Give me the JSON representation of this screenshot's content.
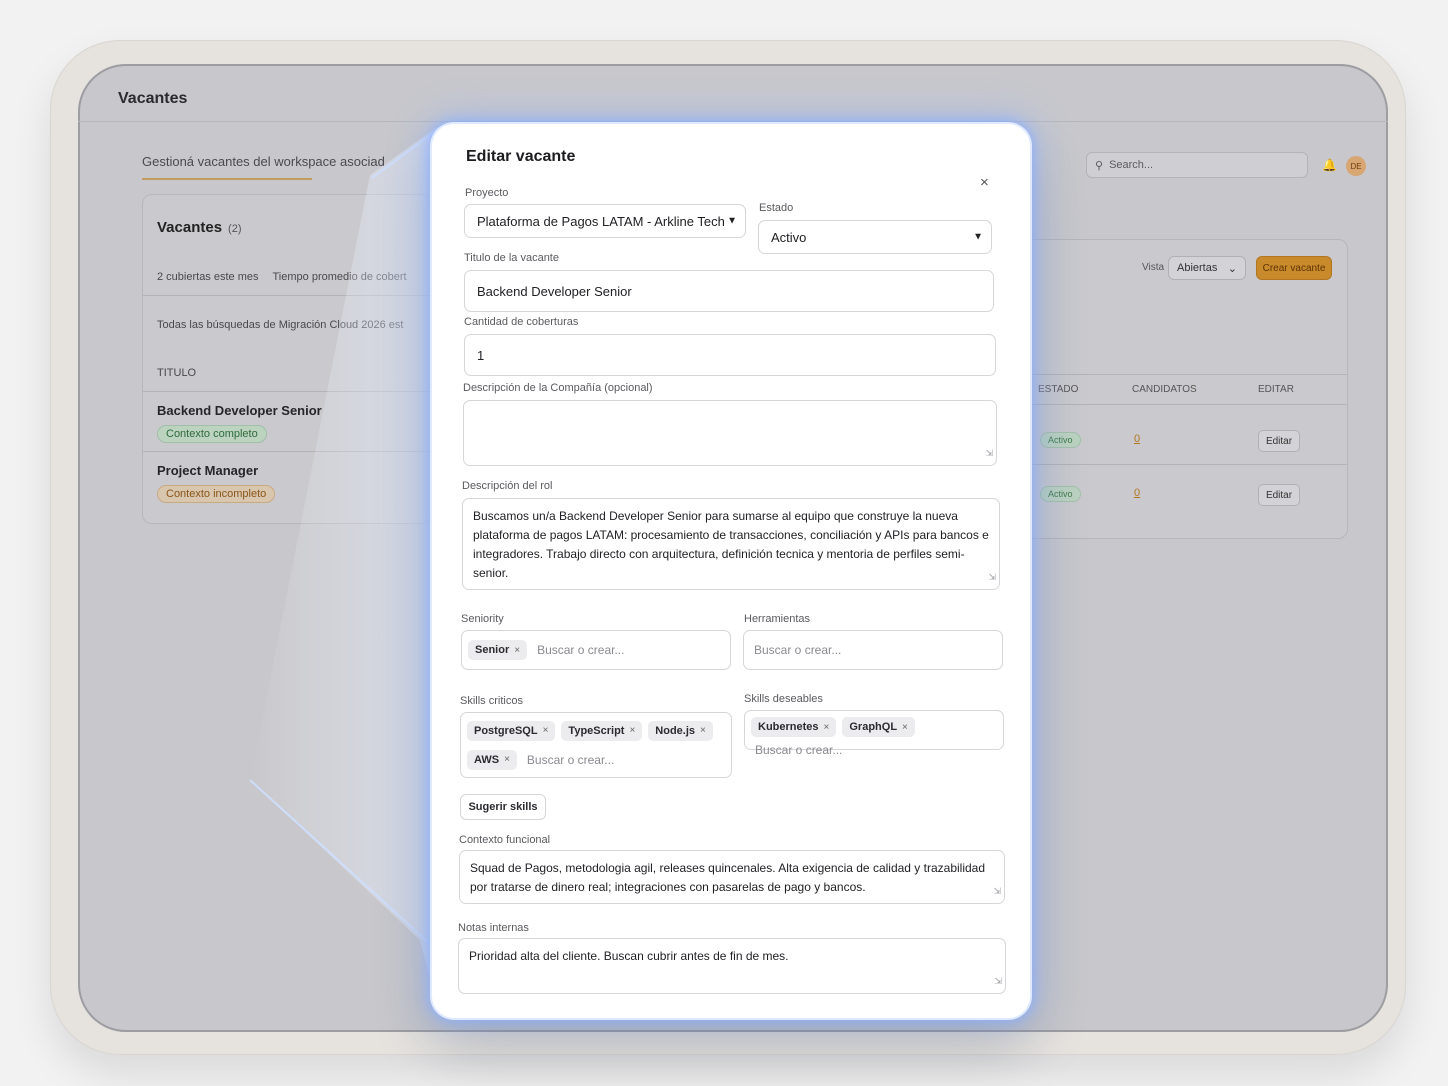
{
  "app": {
    "title": "Vacantes",
    "subtitle": "Gestioná vacantes del workspace asociad",
    "search_placeholder": "Search...",
    "avatar_initials": "DE"
  },
  "left_panel": {
    "title": "Vacantes",
    "count": "(2)",
    "stats": [
      "2 cubiertas este mes",
      "Tiempo promedio de cobert"
    ],
    "note": "Todas las búsquedas de Migración Cloud 2026 est",
    "column_header": "TITULO",
    "rows": [
      {
        "title": "Backend Developer Senior",
        "badge": "Contexto completo"
      },
      {
        "title": "Project Manager",
        "badge": "Contexto incompleto"
      }
    ]
  },
  "right_panel": {
    "vista_label": "Vista",
    "vista_value": "Abiertas",
    "create_button": "Crear vacante",
    "columns": [
      "ESTADO",
      "CANDIDATOS",
      "EDITAR"
    ],
    "rows": [
      {
        "estado": "Activo",
        "candidatos": "0",
        "edit": "Editar"
      },
      {
        "estado": "Activo",
        "candidatos": "0",
        "edit": "Editar"
      }
    ]
  },
  "modal": {
    "title": "Editar vacante",
    "close": "×",
    "proyecto_label": "Proyecto",
    "proyecto_value": "Plataforma de Pagos LATAM - Arkline Techn",
    "estado_label": "Estado",
    "estado_value": "Activo",
    "titulo_label": "Titulo de la vacante",
    "titulo_value": "Backend Developer Senior",
    "cantidad_label": "Cantidad de coberturas",
    "cantidad_value": "1",
    "desc_compania_label": "Descripción de la Compañía (opcional)",
    "desc_compania_value": "",
    "desc_rol_label": "Descripción del rol",
    "desc_rol_value": "Buscamos un/a Backend Developer Senior para sumarse al equipo que construye la nueva plataforma de pagos LATAM: procesamiento de transacciones, conciliación y APIs para bancos e integradores. Trabajo directo con arquitectura, definición tecnica y mentoria de perfiles semi-senior.",
    "seniority_label": "Seniority",
    "seniority_tags": [
      "Senior"
    ],
    "herramientas_label": "Herramientas",
    "skills_criticos_label": "Skills criticos",
    "skills_criticos_tags": [
      "PostgreSQL",
      "TypeScript",
      "Node.js",
      "AWS"
    ],
    "skills_deseables_label": "Skills deseables",
    "skills_deseables_tags": [
      "Kubernetes",
      "GraphQL"
    ],
    "tag_placeholder": "Buscar o crear...",
    "sugerir_button": "Sugerir skills",
    "contexto_label": "Contexto funcional",
    "contexto_value": "Squad de Pagos, metodologia agil, releases quincenales. Alta exigencia de calidad y trazabilidad por tratarse de dinero real; integraciones con pasarelas de pago y bancos.",
    "notas_label": "Notas internas",
    "notas_value": "Prioridad alta del cliente. Buscan cubrir antes de fin de mes."
  }
}
